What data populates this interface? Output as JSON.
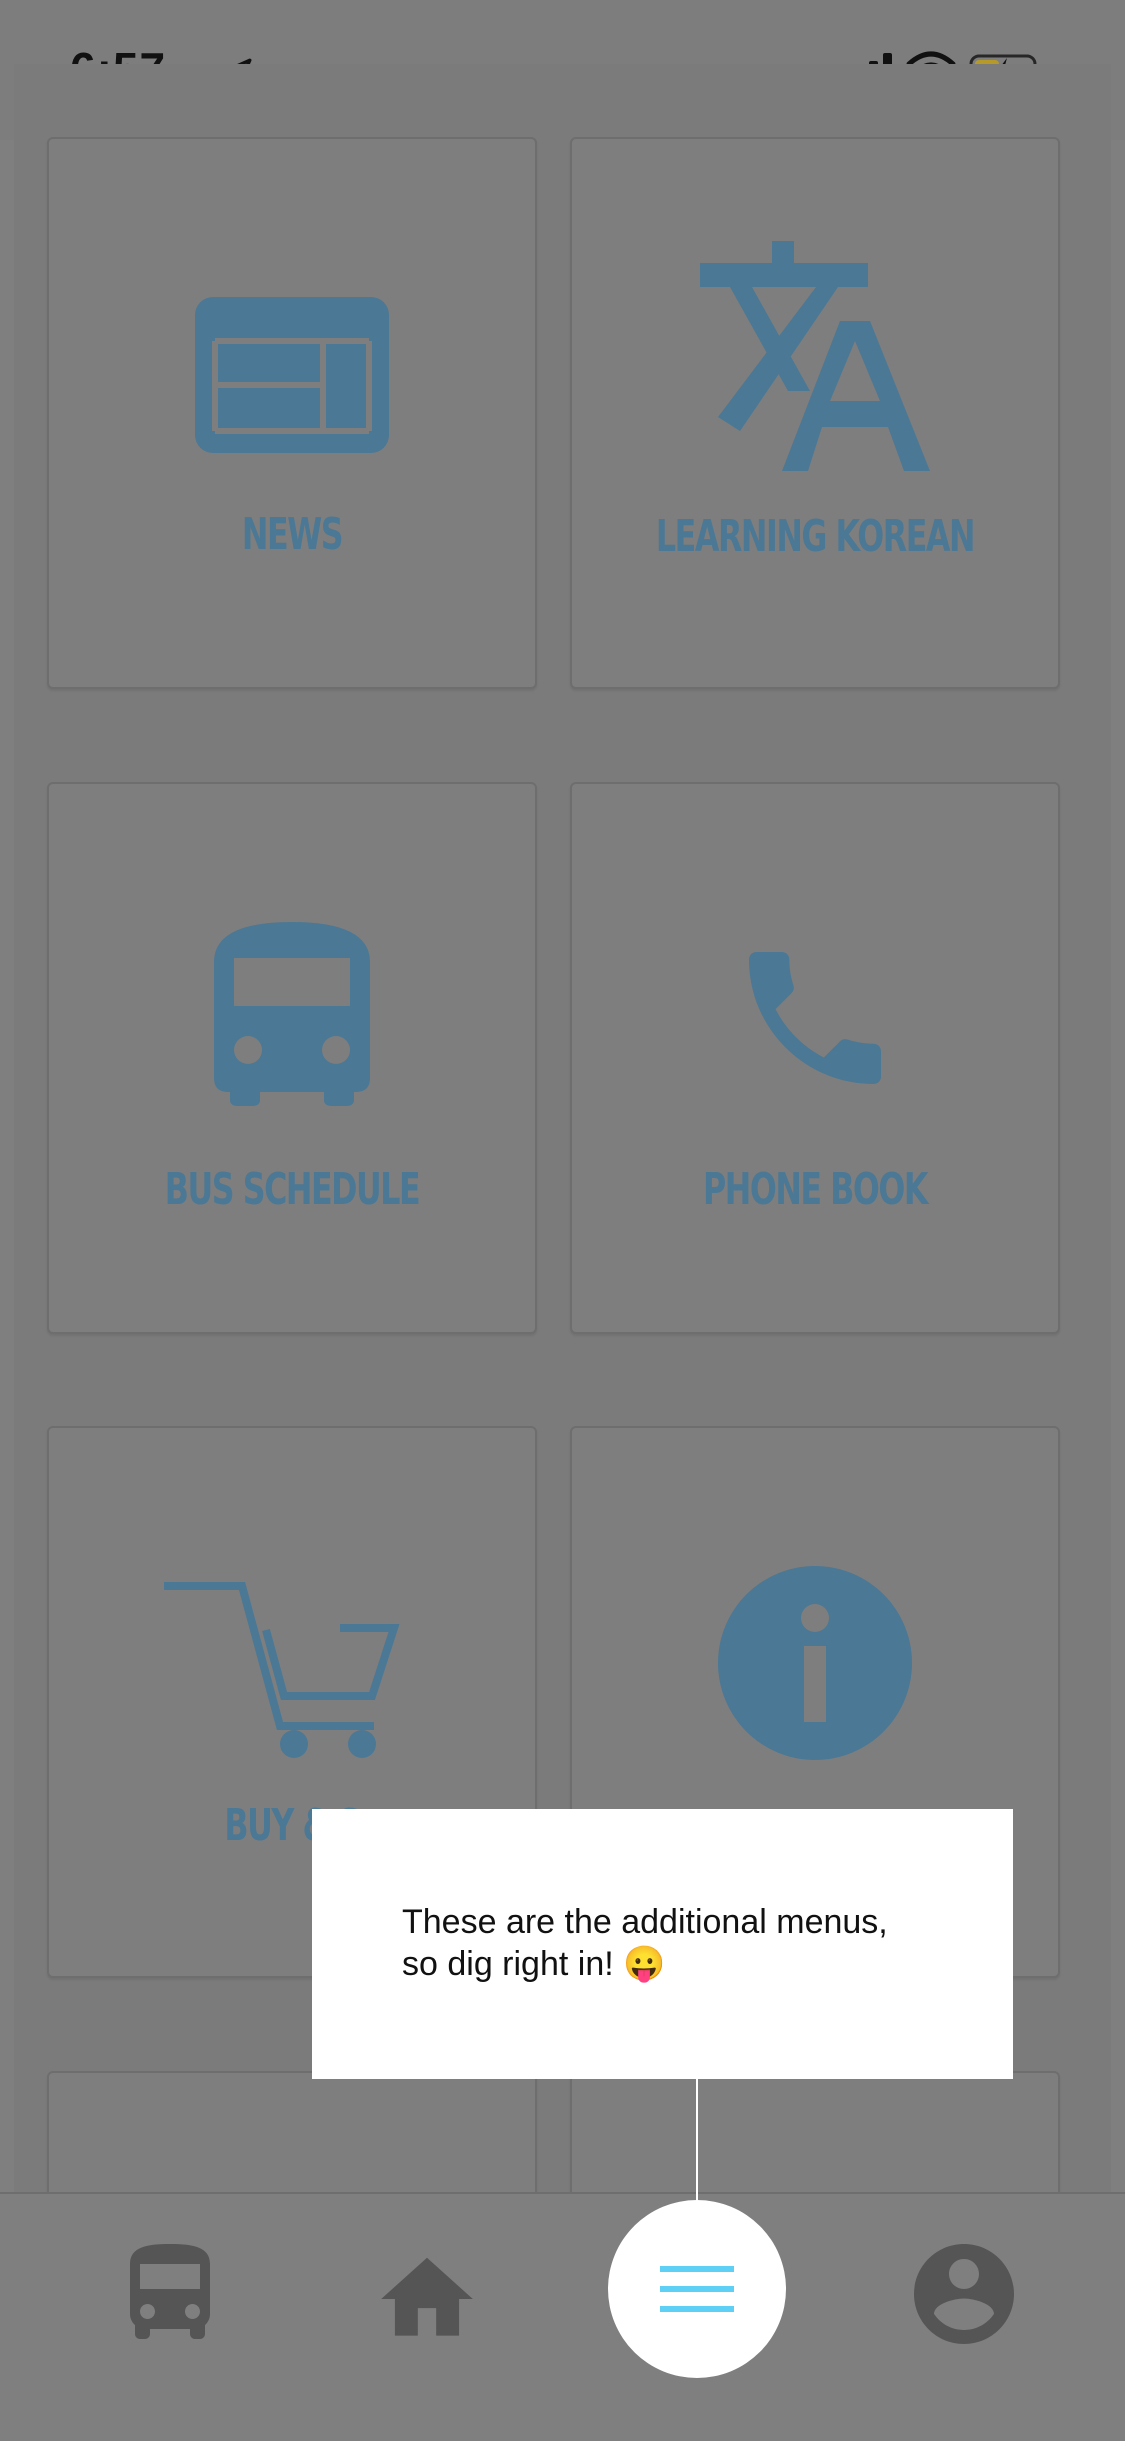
{
  "status_bar": {
    "time": "6:57"
  },
  "cards": [
    {
      "label": "NEWS",
      "icon": "newspaper-icon"
    },
    {
      "label": "LEARNING KOREAN",
      "icon": "translate-icon"
    },
    {
      "label": "BUS SCHEDULE",
      "icon": "bus-icon"
    },
    {
      "label": "PHONE BOOK",
      "icon": "phone-icon"
    },
    {
      "label": "BUY & S",
      "icon": "cart-icon"
    },
    {
      "label": "",
      "icon": "info-icon"
    }
  ],
  "tooltip": {
    "line1": "These are the additional menus,",
    "line2": "so dig right in! 😛"
  },
  "bottom_nav": {
    "items": [
      {
        "icon": "bus-icon"
      },
      {
        "icon": "home-icon"
      },
      {
        "icon": "menu-icon"
      },
      {
        "icon": "account-icon"
      }
    ]
  },
  "colors": {
    "overlay": "#7f7f7f",
    "icon_accent": "#4b7895",
    "menu_accent": "#5ed0f5",
    "nav_icon": "#555555"
  }
}
